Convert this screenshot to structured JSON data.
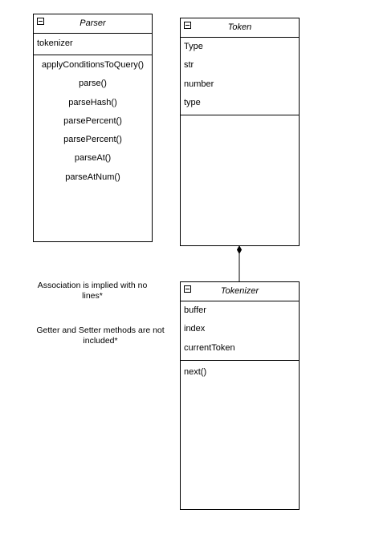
{
  "classes": {
    "parser": {
      "name": "Parser",
      "attributes": [
        "tokenizer"
      ],
      "methods": [
        "applyConditionsToQuery()",
        "parse()",
        "parseHash()",
        "parsePercent()",
        "parsePercent()",
        "parseAt()",
        "parseAtNum()"
      ]
    },
    "token": {
      "name": "Token",
      "attributes": [
        "Type",
        "str",
        "number",
        "type"
      ],
      "methods": []
    },
    "tokenizer": {
      "name": "Tokenizer",
      "attributes": [
        "buffer",
        "index",
        "currentToken"
      ],
      "methods": [
        "next()"
      ]
    }
  },
  "notes": {
    "association": "Association is implied with no lines*",
    "getters": "Getter and Setter methods are not included*"
  },
  "relationship": {
    "type": "composition",
    "from": "Tokenizer",
    "to": "Token"
  }
}
